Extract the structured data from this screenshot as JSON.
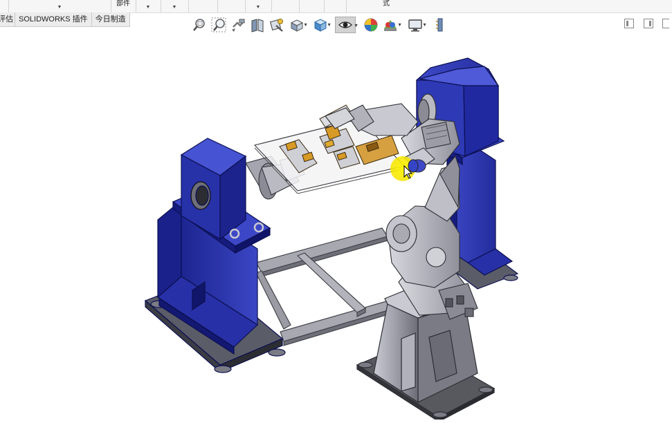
{
  "command_strip": {
    "label_left": "部件",
    "label_right": "式"
  },
  "tabs": [
    {
      "label": "评估"
    },
    {
      "label": "SOLIDWORKS 插件"
    },
    {
      "label": "今日制造"
    }
  ],
  "view_toolbar": {
    "buttons": [
      {
        "icon": "zoom-to-fit-icon"
      },
      {
        "icon": "zoom-to-area-icon"
      },
      {
        "icon": "previous-view-icon"
      },
      {
        "icon": "section-view-icon"
      },
      {
        "icon": "dynamic-annotation-views-icon"
      },
      {
        "icon": "view-orientation-icon"
      },
      {
        "icon": "display-style-icon"
      },
      {
        "icon": "hide-show-items-icon"
      },
      {
        "icon": "edit-appearance-icon"
      },
      {
        "icon": "apply-scene-icon"
      },
      {
        "icon": "view-settings-icon"
      },
      {
        "icon": "rotate-view-icon"
      }
    ]
  },
  "colors": {
    "positioner_blue": "#2c36a8",
    "robot_grey": "#b9bac2",
    "frame_grey": "#9c9ca4",
    "cursor_highlight": "#f5e400"
  }
}
